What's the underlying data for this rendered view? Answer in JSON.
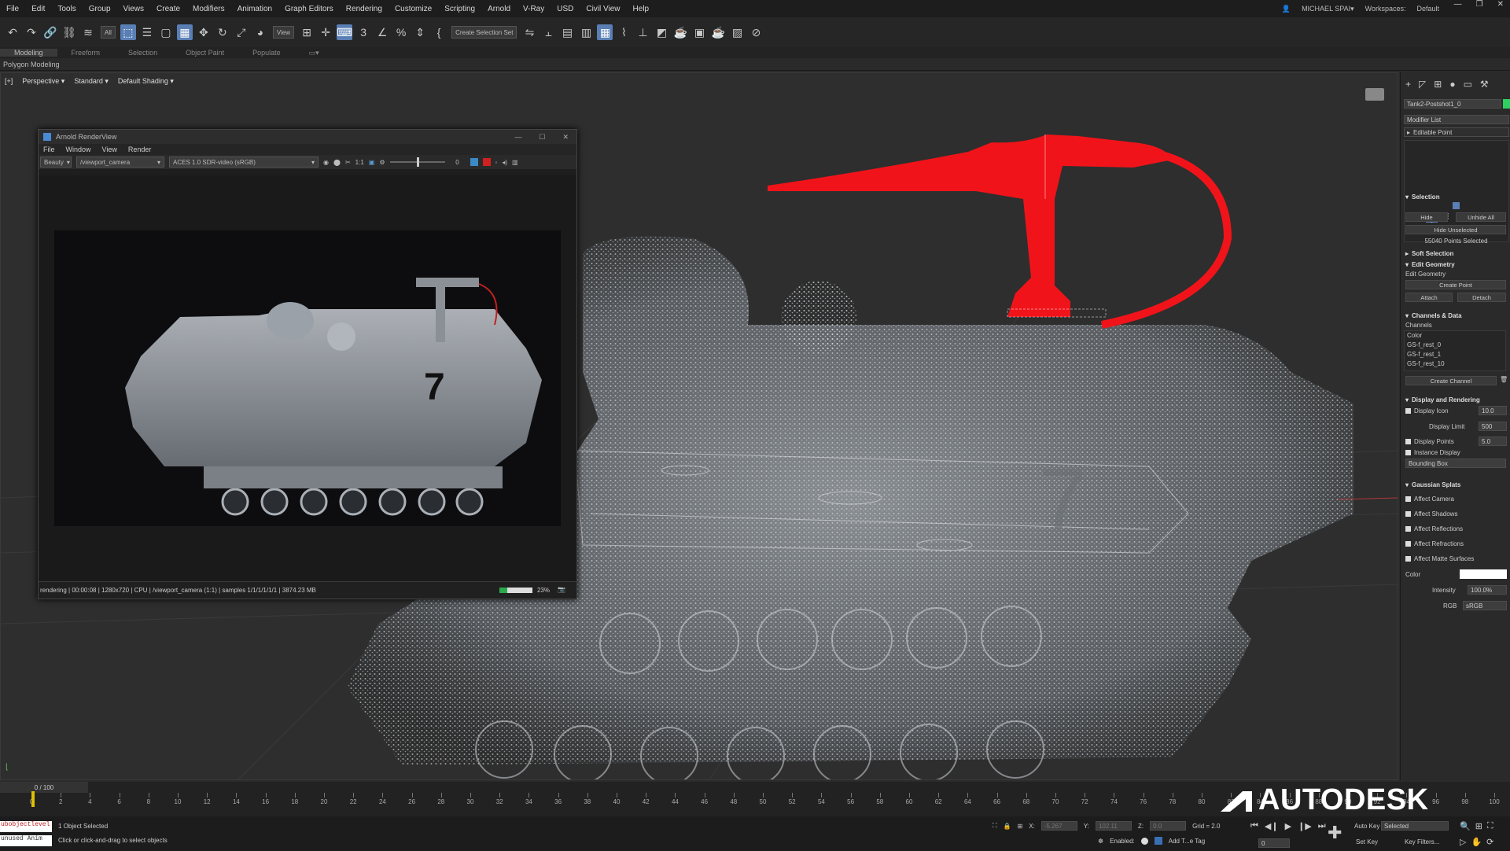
{
  "menubar": {
    "items": [
      "File",
      "Edit",
      "Tools",
      "Group",
      "Views",
      "Create",
      "Modifiers",
      "Animation",
      "Graph Editors",
      "Rendering",
      "Customize",
      "Scripting",
      "Arnold",
      "V-Ray",
      "USD",
      "Civil View",
      "Help"
    ],
    "user": "MICHAEL SPAI▾",
    "workspaces_label": "Workspaces:",
    "workspace": "Default"
  },
  "toolbar": {
    "filter_select": "All",
    "view_select": "View",
    "selection_set": "Create Selection Set"
  },
  "ribbon": {
    "tabs": [
      "Modeling",
      "Freeform",
      "Selection",
      "Object Paint",
      "Populate"
    ],
    "sub": "Polygon Modeling"
  },
  "viewport": {
    "labels": [
      "[+]",
      "Perspective ▾",
      "Standard ▾",
      "Default Shading ▾"
    ]
  },
  "arnold": {
    "title": "Arnold RenderView",
    "menu": [
      "File",
      "Window",
      "View",
      "Render"
    ],
    "aov": "Beauty",
    "camera": "/viewport_camera",
    "colorspace": "ACES 1.0 SDR-video (sRGB)",
    "zoom": "1:1",
    "exposure": "0",
    "status": "rendering | 00:00:08 | 1280x720 | CPU | /viewport_camera (1:1) | samples 1/1/1/1/1/1 | 3874.23 MB",
    "progress_label": "23%",
    "progress": 0.23
  },
  "cmdpanel": {
    "object_name": "Tank2-Postshot1_0",
    "modifier_list": "Modifier List",
    "stack_item": "Editable Point",
    "selection_header": "Selection",
    "hide": "Hide",
    "unhide_all": "Unhide All",
    "hide_unselected": "Hide Unselected",
    "points_selected": "55040 Points Selected",
    "soft_selection": "Soft Selection",
    "edit_geometry": "Edit Geometry",
    "edit_geometry_label": "Edit Geometry",
    "create_point": "Create Point",
    "attach": "Attach",
    "detach": "Detach",
    "channels_header": "Channels & Data",
    "channels_label": "Channels",
    "channels": [
      "Color",
      "GS-f_rest_0",
      "GS-f_rest_1",
      "GS-f_rest_10"
    ],
    "create_channel": "Create Channel",
    "display_header": "Display and Rendering",
    "display_icon": "Display Icon",
    "display_icon_val": "10.0",
    "display_limit": "Display Limit",
    "display_limit_val": "500",
    "display_points": "Display Points",
    "display_points_val": "5.0",
    "instance_display": "Instance Display",
    "bounding_box": "Bounding Box",
    "gaussian_header": "Gaussian Splats",
    "affect": [
      "Affect Camera",
      "Affect Shadows",
      "Affect Reflections",
      "Affect Refractions",
      "Affect Matte Surfaces"
    ],
    "color_label": "Color",
    "intensity_label": "Intensity",
    "intensity_val": "100.0%",
    "rgb_label": "RGB",
    "rgb_val": "sRGB"
  },
  "timeline": {
    "frame": "0 / 100",
    "ticks": [
      "0",
      "2",
      "4",
      "6",
      "8",
      "10",
      "12",
      "14",
      "16",
      "18",
      "20",
      "22",
      "24",
      "26",
      "28",
      "30",
      "32",
      "34",
      "36",
      "38",
      "40",
      "42",
      "44",
      "46",
      "48",
      "50",
      "52",
      "54",
      "56",
      "58",
      "60",
      "62",
      "64",
      "66",
      "68",
      "70",
      "72",
      "74",
      "76",
      "78",
      "80",
      "82",
      "84",
      "86",
      "88",
      "90",
      "92",
      "94",
      "96",
      "98",
      "100"
    ]
  },
  "status": {
    "script1": "ubobjectlevel",
    "script2": "unused Anim",
    "selected": "1 Object Selected",
    "hint": "Click or click-and-drag to select objects",
    "x_label": "X:",
    "x_val": "-5.267",
    "y_label": "Y:",
    "y_val": "102.11",
    "z_label": "Z:",
    "z_val": "0.0",
    "grid": "Grid = 2.0",
    "enabled": "Enabled:",
    "add_tag": "Add T...e Tag",
    "autokey": "Auto Key",
    "selected_dd": "Selected",
    "setkey": "Set Key",
    "keyfilters": "Key Filters...",
    "frame_field": "0"
  },
  "watermark": "AUTODESK"
}
